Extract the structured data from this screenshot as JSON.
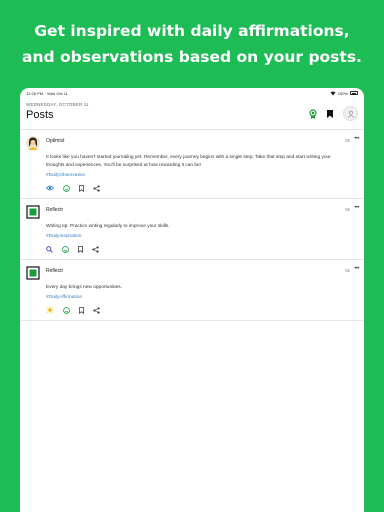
{
  "promo": {
    "line1": "Get inspired with daily affirmations,",
    "line2": "and observations based on your posts."
  },
  "statusbar": {
    "time": "12:26 PM",
    "date": "Wed Oct 11",
    "battery": "100%"
  },
  "header": {
    "date": "WEDNESDAY, OCTOBER 11",
    "title": "Posts"
  },
  "posts": [
    {
      "author": "Optimist",
      "time": "0s",
      "body": "It looks like you haven't started journaling yet. Remember, every journey begins with a single step. Take that step and start writing your thoughts and experiences. You'll be surprised at how rewarding it can be!",
      "tag": "#DailyObservation",
      "icon": "eye-icon"
    },
    {
      "author": "Reflectr",
      "time": "0s",
      "body": "Writing tip: Practice writing regularly to improve your skills.",
      "tag": "#DailyInspiration",
      "icon": "magnify-icon"
    },
    {
      "author": "Reflectr",
      "time": "0s",
      "body": "Every day brings new opportunities.",
      "tag": "#DailyAffirmation",
      "icon": "sun-icon"
    }
  ],
  "fab": {
    "label": "+"
  },
  "colors": {
    "background": "#1ebc55",
    "accent": "#3b82c4",
    "fab": "#1e88e5",
    "reflectr_logo": "#1a9c3e"
  }
}
